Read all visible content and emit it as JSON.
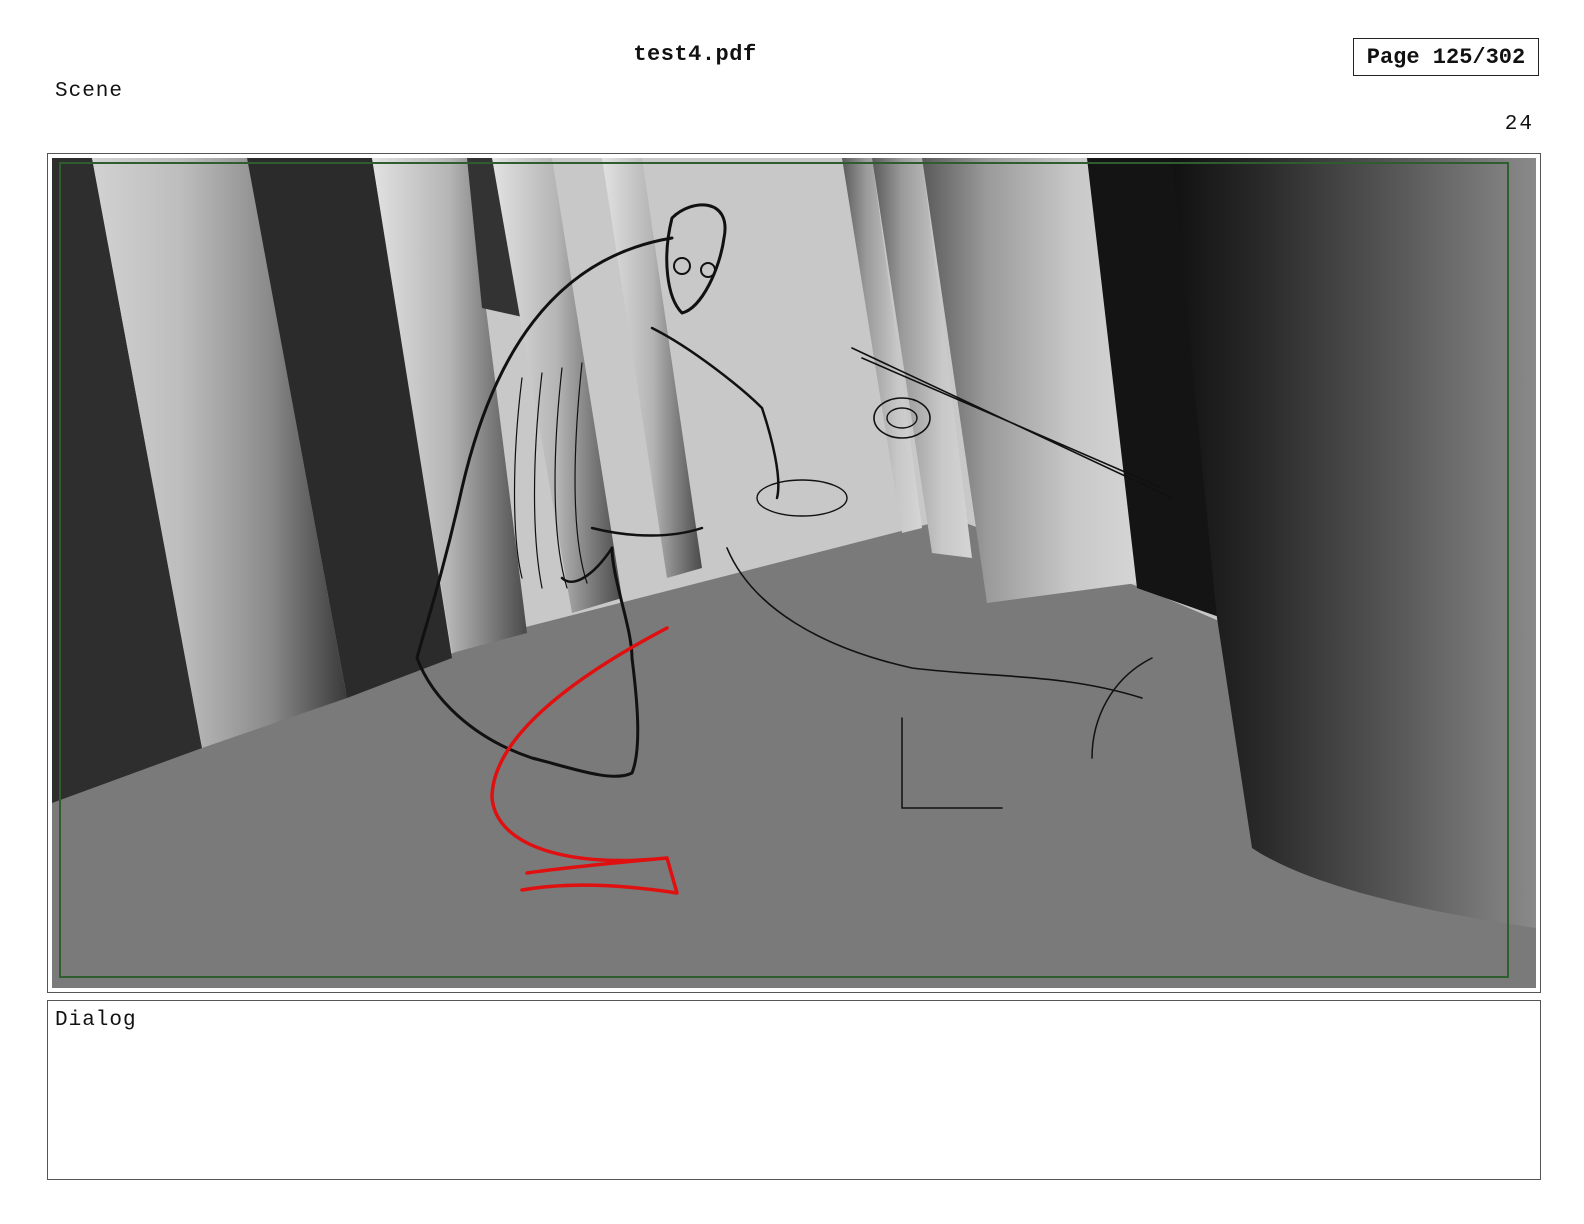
{
  "header": {
    "document_title": "test4.pdf",
    "page_indicator": "Page 125/302"
  },
  "scene": {
    "label": "Scene",
    "number": "24"
  },
  "panel": {
    "colors": {
      "floor": "#7a7a7a",
      "back_wall": "#c8c8c8",
      "safe_frame": "#2e5e2e",
      "sketch_lines": "#111111",
      "red_annotation": "#e01010"
    }
  },
  "dialog": {
    "label": "Dialog"
  }
}
